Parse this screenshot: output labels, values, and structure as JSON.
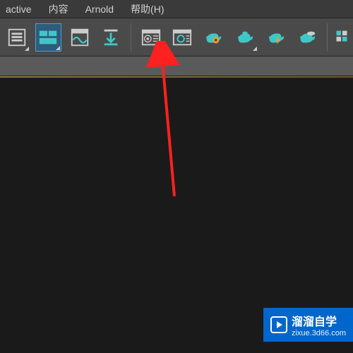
{
  "menu": {
    "items": [
      "active",
      "内容",
      "Arnold",
      "帮助(H)"
    ]
  },
  "toolbar": {
    "icons": [
      {
        "name": "layers-icon",
        "selected": false
      },
      {
        "name": "panels-icon",
        "selected": true
      },
      {
        "name": "wave-window-icon",
        "selected": false
      },
      {
        "name": "download-icon",
        "selected": false
      },
      {
        "name": "render-setup-icon",
        "selected": false
      },
      {
        "name": "render-frame-icon",
        "selected": false
      },
      {
        "name": "teapot-gear-icon",
        "selected": false
      },
      {
        "name": "teapot-icon",
        "selected": false
      },
      {
        "name": "teapot-bolt-icon",
        "selected": false
      },
      {
        "name": "teapot-cloud-icon",
        "selected": false
      },
      {
        "name": "grid-icon",
        "selected": false
      }
    ]
  },
  "colors": {
    "accent": "#3fc7c7",
    "cyan": "#3fc7c7",
    "selected": "#2e5c7a",
    "arrow": "#ff2020",
    "watermark": "#0066cc"
  },
  "watermark": {
    "brand": "溜溜自学",
    "url": "zixue.3d66.com"
  }
}
